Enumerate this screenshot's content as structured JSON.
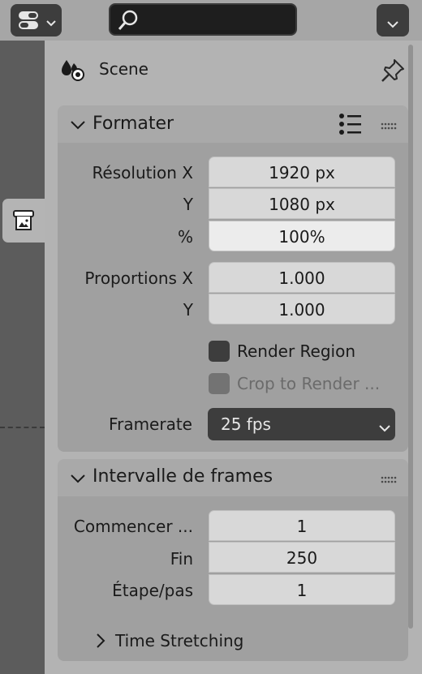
{
  "header": {
    "editor_type_icon": "properties-editor-icon",
    "search": {
      "value": "",
      "placeholder": ""
    }
  },
  "tabs": [
    {
      "name": "render",
      "icon": "render-icon",
      "active": true
    }
  ],
  "context": {
    "label": "Scene",
    "icon": "scene-icon"
  },
  "format_panel": {
    "title": "Formater",
    "resolution_x_label": "Résolution X",
    "resolution_x_value": "1920 px",
    "resolution_y_label": "Y",
    "resolution_y_value": "1080 px",
    "percent_label": "%",
    "percent_value": "100%",
    "aspect_x_label": "Proportions X",
    "aspect_x_value": "1.000",
    "aspect_y_label": "Y",
    "aspect_y_value": "1.000",
    "render_region_label": "Render Region",
    "render_region_checked": false,
    "crop_label": "Crop to Render ...",
    "crop_checked": false,
    "crop_enabled": false,
    "framerate_label": "Framerate",
    "framerate_value": "25 fps"
  },
  "frame_range_panel": {
    "title": "Intervalle de frames",
    "start_label": "Commencer ...",
    "start_value": "1",
    "end_label": "Fin",
    "end_value": "250",
    "step_label": "Étape/pas",
    "step_value": "1",
    "time_stretching_label": "Time Stretching",
    "time_stretching_expanded": false
  },
  "colors": {
    "editor_bg": "#b3b3b3",
    "panel_body": "#a0a0a0",
    "field": "#d8d8d8",
    "dark_widget": "#3d3d3d",
    "tab_column": "#5c5c5c"
  }
}
